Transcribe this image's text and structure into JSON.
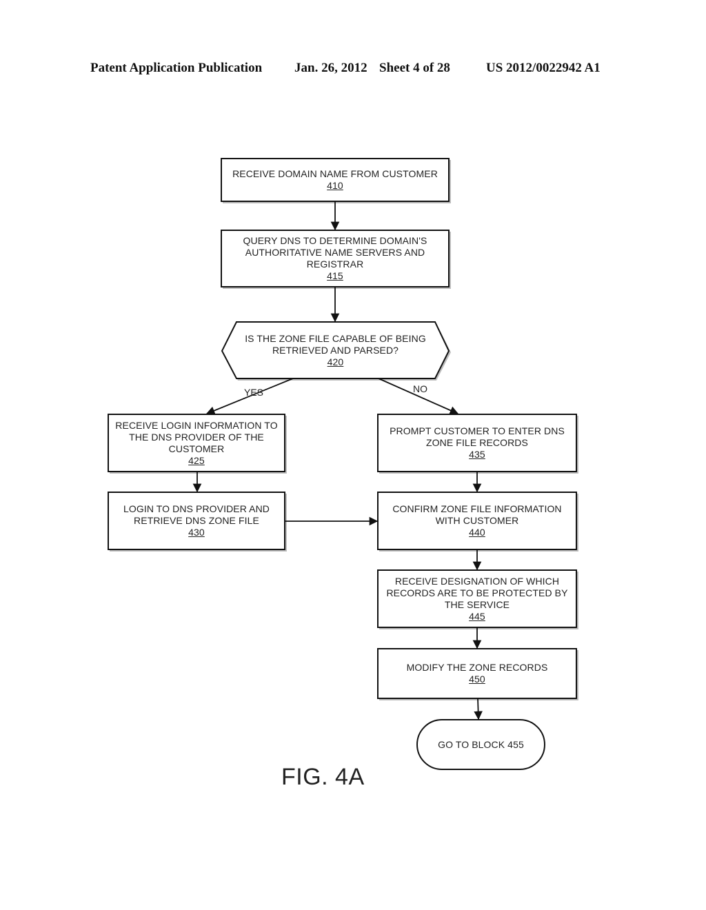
{
  "header": {
    "publication_type": "Patent Application Publication",
    "date": "Jan. 26, 2012",
    "sheet": "Sheet 4 of 28",
    "publication_number": "US 2012/0022942 A1"
  },
  "flowchart": {
    "nodes": {
      "n410": {
        "type": "process",
        "lines": [
          "RECEIVE DOMAIN NAME FROM CUSTOMER"
        ],
        "ref": "410"
      },
      "n415": {
        "type": "process",
        "lines": [
          "QUERY DNS TO DETERMINE DOMAIN'S",
          "AUTHORITATIVE NAME SERVERS AND",
          "REGISTRAR"
        ],
        "ref": "415"
      },
      "n420": {
        "type": "decision",
        "lines": [
          "IS THE ZONE FILE CAPABLE OF BEING",
          "RETRIEVED AND PARSED?"
        ],
        "ref": "420"
      },
      "n425": {
        "type": "process",
        "lines": [
          "RECEIVE LOGIN INFORMATION TO",
          "THE DNS PROVIDER OF THE",
          "CUSTOMER"
        ],
        "ref": "425"
      },
      "n430": {
        "type": "process",
        "lines": [
          "LOGIN TO DNS PROVIDER AND",
          "RETRIEVE DNS ZONE FILE"
        ],
        "ref": "430"
      },
      "n435": {
        "type": "process",
        "lines": [
          "PROMPT CUSTOMER TO ENTER DNS",
          "ZONE FILE RECORDS"
        ],
        "ref": "435"
      },
      "n440": {
        "type": "process",
        "lines": [
          "CONFIRM ZONE FILE INFORMATION",
          "WITH CUSTOMER"
        ],
        "ref": "440"
      },
      "n445": {
        "type": "process",
        "lines": [
          "RECEIVE DESIGNATION OF WHICH",
          "RECORDS ARE TO BE PROTECTED BY",
          "THE SERVICE"
        ],
        "ref": "445"
      },
      "n450": {
        "type": "process",
        "lines": [
          "MODIFY THE ZONE RECORDS"
        ],
        "ref": "450"
      },
      "n455": {
        "type": "terminal",
        "lines": [
          "GO TO BLOCK 455"
        ],
        "ref": ""
      }
    },
    "edges": [
      {
        "from": "410",
        "to": "415",
        "label": ""
      },
      {
        "from": "415",
        "to": "420",
        "label": ""
      },
      {
        "from": "420",
        "to": "425",
        "label": "YES"
      },
      {
        "from": "420",
        "to": "435",
        "label": "NO"
      },
      {
        "from": "425",
        "to": "430",
        "label": ""
      },
      {
        "from": "430",
        "to": "440",
        "label": ""
      },
      {
        "from": "435",
        "to": "440",
        "label": ""
      },
      {
        "from": "440",
        "to": "445",
        "label": ""
      },
      {
        "from": "445",
        "to": "450",
        "label": ""
      },
      {
        "from": "450",
        "to": "455",
        "label": ""
      }
    ],
    "branch_labels": {
      "yes": "YES",
      "no": "NO"
    }
  },
  "figure_label": "FIG. 4A"
}
